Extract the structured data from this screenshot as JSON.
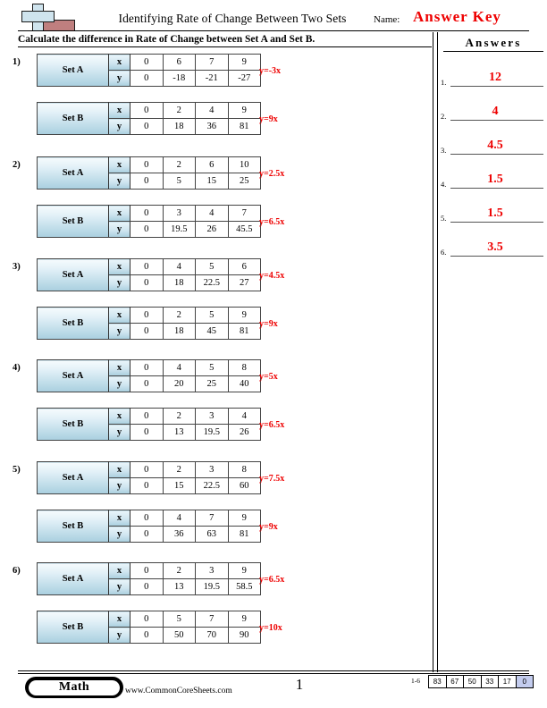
{
  "header": {
    "title": "Identifying Rate of Change Between Two Sets",
    "name_label": "Name:",
    "answer_key": "Answer Key",
    "instructions": "Calculate the difference in Rate of Change between Set A and Set B.",
    "logo": "commoncoresheets-plus-logo"
  },
  "answers_panel": {
    "heading": "Answers",
    "rows": [
      {
        "num": "1.",
        "value": "12"
      },
      {
        "num": "2.",
        "value": "4"
      },
      {
        "num": "3.",
        "value": "4.5"
      },
      {
        "num": "4.",
        "value": "1.5"
      },
      {
        "num": "5.",
        "value": "1.5"
      },
      {
        "num": "6.",
        "value": "3.5"
      }
    ]
  },
  "table_labels": {
    "set_a": "Set A",
    "set_b": "Set B",
    "x": "x",
    "y": "y"
  },
  "problems": [
    {
      "num": "1)",
      "sets": [
        {
          "name": "Set A",
          "x": [
            "0",
            "6",
            "7",
            "9"
          ],
          "y": [
            "0",
            "-18",
            "-21",
            "-27"
          ],
          "equation": "y=-3x"
        },
        {
          "name": "Set B",
          "x": [
            "0",
            "2",
            "4",
            "9"
          ],
          "y": [
            "0",
            "18",
            "36",
            "81"
          ],
          "equation": "y=9x"
        }
      ]
    },
    {
      "num": "2)",
      "sets": [
        {
          "name": "Set A",
          "x": [
            "0",
            "2",
            "6",
            "10"
          ],
          "y": [
            "0",
            "5",
            "15",
            "25"
          ],
          "equation": "y=2.5x"
        },
        {
          "name": "Set B",
          "x": [
            "0",
            "3",
            "4",
            "7"
          ],
          "y": [
            "0",
            "19.5",
            "26",
            "45.5"
          ],
          "equation": "y=6.5x"
        }
      ]
    },
    {
      "num": "3)",
      "sets": [
        {
          "name": "Set A",
          "x": [
            "0",
            "4",
            "5",
            "6"
          ],
          "y": [
            "0",
            "18",
            "22.5",
            "27"
          ],
          "equation": "y=4.5x"
        },
        {
          "name": "Set B",
          "x": [
            "0",
            "2",
            "5",
            "9"
          ],
          "y": [
            "0",
            "18",
            "45",
            "81"
          ],
          "equation": "y=9x"
        }
      ]
    },
    {
      "num": "4)",
      "sets": [
        {
          "name": "Set A",
          "x": [
            "0",
            "4",
            "5",
            "8"
          ],
          "y": [
            "0",
            "20",
            "25",
            "40"
          ],
          "equation": "y=5x"
        },
        {
          "name": "Set B",
          "x": [
            "0",
            "2",
            "3",
            "4"
          ],
          "y": [
            "0",
            "13",
            "19.5",
            "26"
          ],
          "equation": "y=6.5x"
        }
      ]
    },
    {
      "num": "5)",
      "sets": [
        {
          "name": "Set A",
          "x": [
            "0",
            "2",
            "3",
            "8"
          ],
          "y": [
            "0",
            "15",
            "22.5",
            "60"
          ],
          "equation": "y=7.5x"
        },
        {
          "name": "Set B",
          "x": [
            "0",
            "4",
            "7",
            "9"
          ],
          "y": [
            "0",
            "36",
            "63",
            "81"
          ],
          "equation": "y=9x"
        }
      ]
    },
    {
      "num": "6)",
      "sets": [
        {
          "name": "Set A",
          "x": [
            "0",
            "2",
            "3",
            "9"
          ],
          "y": [
            "0",
            "13",
            "19.5",
            "58.5"
          ],
          "equation": "y=6.5x"
        },
        {
          "name": "Set B",
          "x": [
            "0",
            "5",
            "7",
            "9"
          ],
          "y": [
            "0",
            "50",
            "70",
            "90"
          ],
          "equation": "y=10x"
        }
      ]
    }
  ],
  "footer": {
    "badge": "Math",
    "url": "www.CommonCoreSheets.com",
    "page_number": "1",
    "score_range": "1-6",
    "score_values": [
      "83",
      "67",
      "50",
      "33",
      "17",
      "0"
    ]
  },
  "colors": {
    "answer_red": "#ee0000",
    "table_header_blue": "#a9cfdf",
    "score_highlight": "#c3ccee",
    "logo_blue": "#cfe4ee",
    "logo_red": "#bf7f7f"
  }
}
